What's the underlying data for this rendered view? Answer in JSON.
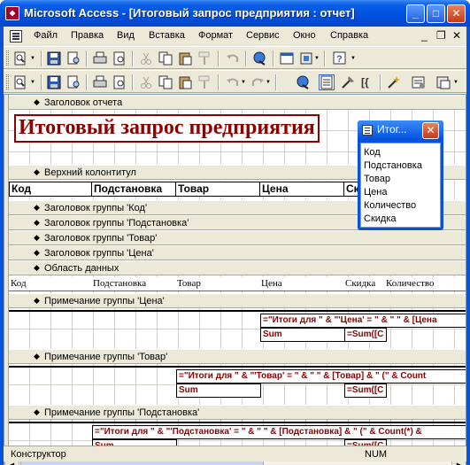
{
  "window": {
    "title": "Microsoft Access - [Итоговый запрос предприятия : отчет]"
  },
  "menu": [
    "Файл",
    "Правка",
    "Вид",
    "Вставка",
    "Формат",
    "Сервис",
    "Окно",
    "Справка"
  ],
  "sections": {
    "report_header": "Заголовок отчета",
    "page_header": "Верхний колонтитул",
    "group_kod": "Заголовок группы 'Код'",
    "group_podst": "Заголовок группы 'Подстановка'",
    "group_tovar": "Заголовок группы 'Товар'",
    "group_cena": "Заголовок группы 'Цена'",
    "detail": "Область данных",
    "footer_cena": "Примечание группы 'Цена'",
    "footer_tovar": "Примечание группы 'Товар'",
    "footer_podst": "Примечание группы 'Подстановка'"
  },
  "report": {
    "title": "Итоговый запрос предприятия",
    "column_headers": [
      "Код",
      "Подстановка",
      "Товар",
      "Цена",
      "Скидка"
    ],
    "detail_fields": [
      "Код",
      "Подстановка",
      "Товар",
      "Цена",
      "Скидка",
      "Количество"
    ],
    "footer_cena": {
      "expr": "=\"Итоги для \" & \"'Цена' = \" & \" \" & [Цена",
      "label": "Sum",
      "sum": "=Sum([C"
    },
    "footer_tovar": {
      "expr": "=\"Итоги для \" & \"'Товар' = \" & \" \" & [Товар] & \" (\" & Count",
      "label": "Sum",
      "sum": "=Sum([C"
    },
    "footer_podst": {
      "expr": "=\"Итоги для \" & \"'Подстановка' = \" & \" \" & [Подстановка] & \" (\" & Count(*) &",
      "label": "Sum",
      "sum": "=Sum([C"
    }
  },
  "field_list": {
    "title": "Итог...",
    "items": [
      "Код",
      "Подстановка",
      "Товар",
      "Цена",
      "Количество",
      "Скидка"
    ]
  },
  "status": {
    "mode": "Конструктор",
    "num": "NUM"
  }
}
